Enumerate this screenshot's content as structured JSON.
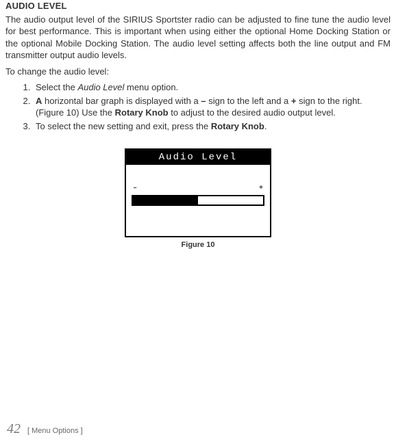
{
  "heading": "AUDIO LEVEL",
  "intro": {
    "prefix": "The audio output level of the SIRIUS Sportster radio can be adjusted to fine tune the audio level for best performance. This is important when using either the optional Home Docking Station or the optional Mobile Docking Station. The audio level setting affects both the line output and FM transmitter output audio levels."
  },
  "change_line": "To change the audio level:",
  "steps": {
    "s1_a": "Select the ",
    "s1_italic": "Audio Level",
    "s1_b": " menu option.",
    "s2_a": "A",
    "s2_b": " horizontal bar graph is displayed with a ",
    "s2_minus": "–",
    "s2_c": " sign to the left and a ",
    "s2_plus": "+",
    "s2_d": " sign to the right. (Figure 10) Use the ",
    "s2_rk1": "Rotary Knob",
    "s2_e": " to adjust to the desired audio output level.",
    "s3_a": "To select the new setting and exit, press the ",
    "s3_rk": "Rotary Knob",
    "s3_b": "."
  },
  "figure": {
    "title": "Audio Level",
    "minus": "–",
    "plus": "+",
    "caption": "Figure 10",
    "fill_percent": 50
  },
  "footer": {
    "page": "42",
    "section": "[ Menu Options ]"
  }
}
